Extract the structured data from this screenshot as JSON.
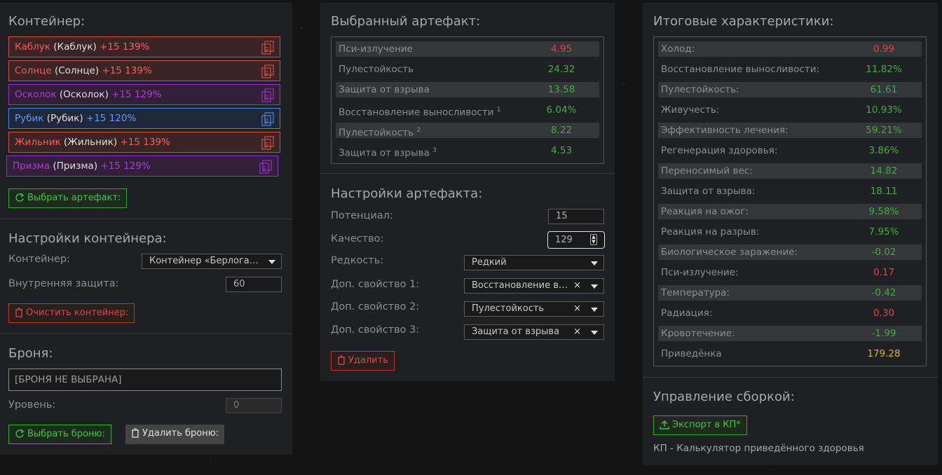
{
  "colors": {
    "red": "#e04444",
    "green": "#3fae3f",
    "yellow": "#e0b020",
    "purple": "#9a2fc0",
    "blue": "#4a86d8"
  },
  "container": {
    "title": "Контейнер:",
    "artifacts": [
      {
        "name": "Каблук",
        "orig": "(Каблук)",
        "level": "+15 139%",
        "color": "red"
      },
      {
        "name": "Солнце",
        "orig": "(Солнце)",
        "level": "+15 139%",
        "color": "red"
      },
      {
        "name": "Осколок",
        "orig": "(Осколок)",
        "level": "+15 129%",
        "color": "purple"
      },
      {
        "name": "Рубик",
        "orig": "(Рубик)",
        "level": "+15 120%",
        "color": "blue"
      },
      {
        "name": "Жильник",
        "orig": "(Жильник)",
        "level": "+15 139%",
        "color": "red"
      },
      {
        "name": "Призма",
        "orig": "(Призма)",
        "level": "+15 129%",
        "color": "purple"
      }
    ],
    "select_button": "Выбрать артефакт:"
  },
  "container_settings": {
    "title": "Настройки контейнера:",
    "container_label": "Контейнер:",
    "container_value": "Контейнер «Берлога…",
    "protection_label": "Внутренняя защита:",
    "protection_value": "60",
    "clear_button": "Очистить контейнер:"
  },
  "armor": {
    "title": "Броня:",
    "field_value": "[БРОНЯ НЕ ВЫБРАНА]",
    "level_label": "Уровень:",
    "level_value": "0",
    "select_button": "Выбрать броню:",
    "delete_button": "Удалить броню:"
  },
  "selected": {
    "title": "Выбранный артефакт:",
    "stats": [
      {
        "k": "Пси-излучение",
        "sup": "",
        "v": "4.95",
        "c": "red"
      },
      {
        "k": "Пулестойкость",
        "sup": "",
        "v": "24.32",
        "c": "green"
      },
      {
        "k": "Защита от взрыва",
        "sup": "",
        "v": "13.58",
        "c": "green"
      },
      {
        "k": "Восстановление выносливости",
        "sup": "1",
        "v": "6.04%",
        "c": "green"
      },
      {
        "k": "Пулестойкость",
        "sup": "2",
        "v": "8.22",
        "c": "green"
      },
      {
        "k": "Защита от взрыва",
        "sup": "3",
        "v": "4.53",
        "c": "green"
      }
    ]
  },
  "art_settings": {
    "title": "Настройки артефакта:",
    "potential_label": "Потенциал:",
    "potential_value": "15",
    "quality_label": "Качество:",
    "quality_value": "129",
    "rarity_label": "Редкость:",
    "rarity_value": "Редкий",
    "prop1_label": "Доп. свойство 1:",
    "prop1_value": "Восстановление выносливости",
    "prop2_label": "Доп. свойство 2:",
    "prop2_value": "Пулестойкость",
    "prop3_label": "Доп. свойство 3:",
    "prop3_value": "Защита от взрыва",
    "clear_symbol": "×",
    "delete_button": "Удалить"
  },
  "totals": {
    "title": "Итоговые характеристики:",
    "stats": [
      {
        "k": "Холод:",
        "v": "0.99",
        "c": "red"
      },
      {
        "k": "Восстановление выносливости:",
        "v": "11.82%",
        "c": "green"
      },
      {
        "k": "Пулестойкость:",
        "v": "61.61",
        "c": "green"
      },
      {
        "k": "Живучесть:",
        "v": "10.93%",
        "c": "green"
      },
      {
        "k": "Эффективность лечения:",
        "v": "59.21%",
        "c": "green"
      },
      {
        "k": "Регенерация здоровья:",
        "v": "3.86%",
        "c": "green"
      },
      {
        "k": "Переносимый вес:",
        "v": "14.82",
        "c": "green"
      },
      {
        "k": "Защита от взрыва:",
        "v": "18.11",
        "c": "green"
      },
      {
        "k": "Реакция на ожог:",
        "v": "9.58%",
        "c": "green"
      },
      {
        "k": "Реакция на разрыв:",
        "v": "7.95%",
        "c": "green"
      },
      {
        "k": "Биологическое заражение:",
        "v": "-0.02",
        "c": "green"
      },
      {
        "k": "Пси-излучение:",
        "v": "0.17",
        "c": "red"
      },
      {
        "k": "Температура:",
        "v": "-0.42",
        "c": "green"
      },
      {
        "k": "Радиация:",
        "v": "0.30",
        "c": "red"
      },
      {
        "k": "Кровотечение:",
        "v": "-1.99",
        "c": "green"
      },
      {
        "k": "Приведёнка",
        "v": "179.28",
        "c": "yellow"
      }
    ]
  },
  "build": {
    "title": "Управление сборкой:",
    "export_button": "Экспорт в КП*",
    "note": "КП - Калькулятор приведённого здоровья"
  }
}
